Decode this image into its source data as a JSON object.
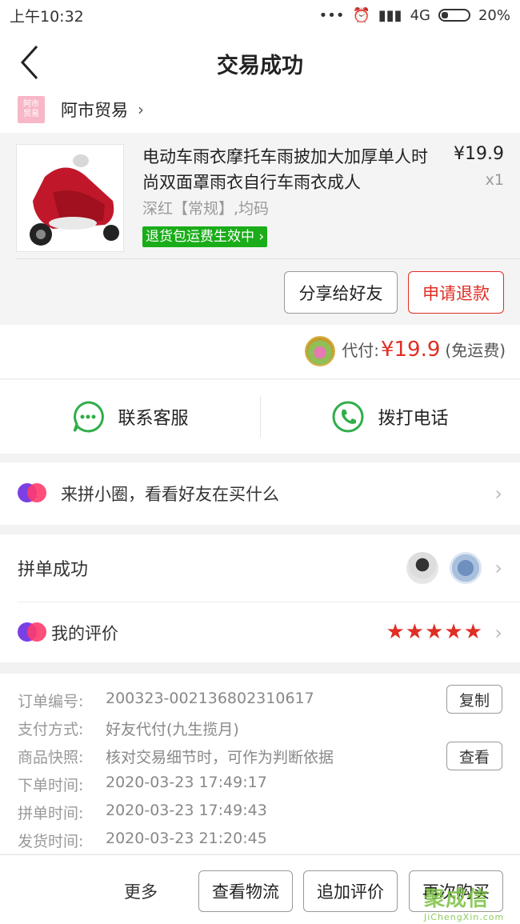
{
  "status_bar": {
    "time": "上午10:32",
    "network": "4G",
    "battery": "20%",
    "dots": "•••"
  },
  "nav": {
    "title": "交易成功"
  },
  "shop": {
    "logo_text": "阿市\n贸易",
    "name": "阿市贸易",
    "chevron": "›"
  },
  "product": {
    "title": "电动车雨衣摩托车雨披加大加厚单人时尚双面罩雨衣自行车雨衣成人",
    "price": "¥19.9",
    "qty": "x1",
    "spec": "深红【常规】,均码",
    "badge": "退货包运费生效中",
    "badge_chevron": "›"
  },
  "actions": {
    "share": "分享给好友",
    "refund": "申请退款"
  },
  "payment": {
    "label": "代付:",
    "amount": "¥19.9",
    "shipping": "(免运费)"
  },
  "contact": {
    "service": "联系客服",
    "call": "拨打电话"
  },
  "circle": {
    "text": "来拼小圈，看看好友在买什么"
  },
  "group": {
    "title": "拼单成功"
  },
  "review": {
    "title": "我的评价",
    "stars": "★★★★★",
    "rating": 5
  },
  "order": {
    "rows": [
      {
        "label": "订单编号:",
        "value": "200323-002136802310617"
      },
      {
        "label": "支付方式:",
        "value": "好友代付(九生揽月)"
      },
      {
        "label": "商品快照:",
        "value": "核对交易细节时，可作为判断依据"
      },
      {
        "label": "下单时间:",
        "value": "2020-03-23 17:49:17"
      },
      {
        "label": "拼单时间:",
        "value": "2020-03-23 17:49:43"
      },
      {
        "label": "发货时间:",
        "value": "2020-03-23 21:20:45"
      }
    ],
    "copy_label": "复制",
    "view_label": "查看"
  },
  "bottom": {
    "more": "更多",
    "logistics": "查看物流",
    "add_review": "追加评价",
    "rebuy": "再次购买"
  },
  "watermark": {
    "top": "聚成信",
    "bottom": "JiChengXin.com"
  },
  "colors": {
    "accent_red": "#e02e24",
    "green": "#1aad19",
    "contact_green": "#2fae4a"
  }
}
